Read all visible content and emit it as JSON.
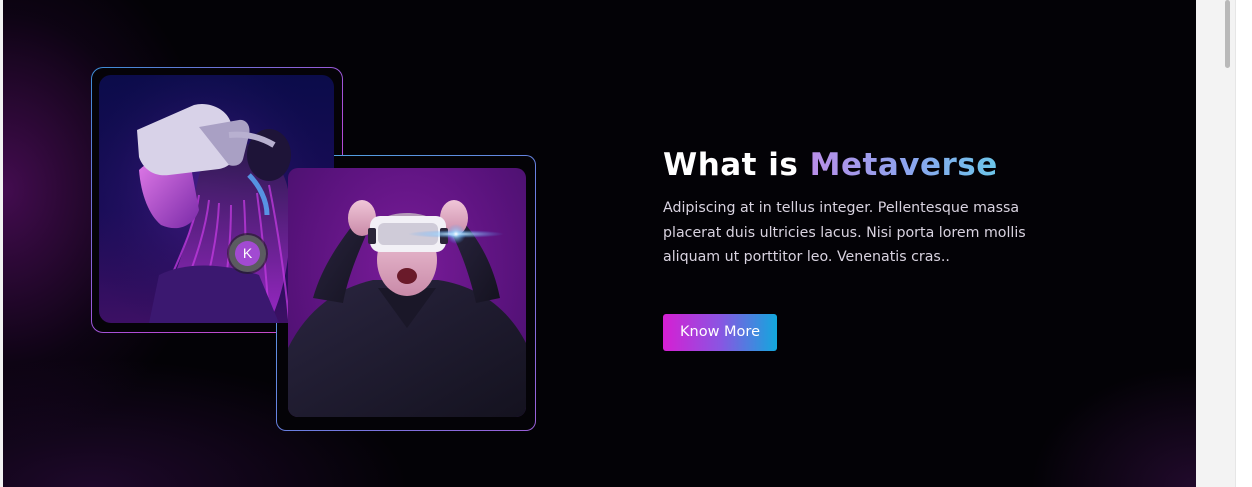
{
  "section": {
    "title_prefix": "What is",
    "title_accent": "Metaverse",
    "description": "Adipiscing at in tellus integer. Pellentesque massa placerat duis ultricies lacus. Nisi porta lorem mollis aliquam ut porttitor leo. Venenatis cras..",
    "cta_label": "Know More"
  },
  "avatar": {
    "initial": "K"
  },
  "images": [
    {
      "name": "vr-headset-woman-looking-up"
    },
    {
      "name": "vr-headset-woman-smiling"
    }
  ],
  "colors": {
    "background": "#030206",
    "accent_magenta": "#d61fd3",
    "accent_blue": "#12a8dd",
    "title_accent_start": "#b98ee8",
    "title_accent_end": "#6cc6ea",
    "avatar_badge": "#a24ad2"
  }
}
